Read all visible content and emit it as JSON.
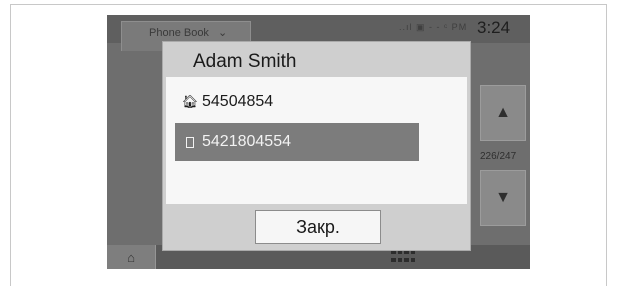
{
  "header": {
    "tab_label": "Phone Book",
    "tab_dropdown_glyph": "⌄",
    "status_icons": "..ıl ▣  - - ᶜ PM",
    "time": "3:24"
  },
  "navigation": {
    "up_glyph": "▲",
    "down_glyph": "▼",
    "counter": "226/247"
  },
  "dialog": {
    "title": "Adam Smith",
    "numbers": [
      {
        "icon": "home-icon",
        "glyph": "🏠︎",
        "value": "54504854",
        "selected": false
      },
      {
        "icon": "mobile-phone-icon",
        "value": "5421804554",
        "selected": true
      }
    ],
    "close_label": "Закр."
  },
  "footer": {
    "home_glyph": "⌂"
  },
  "colors": {
    "screen_bg": "#6e6e6e",
    "dialog_bg": "#cfcfcf",
    "selected_row": "#7c7c7c"
  }
}
